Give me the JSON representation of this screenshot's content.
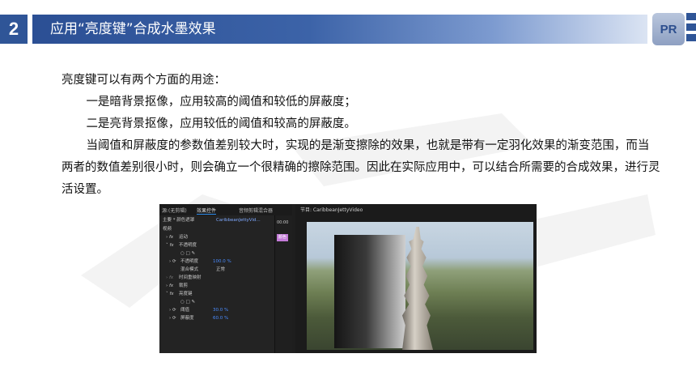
{
  "header": {
    "number": "2",
    "title": "应用“亮度键”合成水墨效果",
    "logo_text": "PR"
  },
  "body": {
    "lines": [
      "亮度键可以有两个方面的用途：",
      "一是暗背景抠像，应用较高的阈值和较低的屏蔽度；",
      "二是亮背景抠像，应用较低的阈值和较高的屏蔽度。",
      "当阈值和屏蔽度的参数值差别较大时，实现的是渐变擦除的效果，也就是带有一定羽化效果的渐变范围，而当两者的数值差别很小时，则会确立一个很精确的擦除范围。因此在实际应用中，可以结合所需要的合成效果，进行灵活设置。"
    ]
  },
  "screenshot": {
    "left_tabs": [
      "源:(无剪辑)",
      "效果控件",
      "音频剪辑混合器"
    ],
    "active_tab": "效果控件",
    "clip_path": "主要 * 颜色遮罩",
    "clip_name": "CaribbeanJettyVid...",
    "time": "00:00",
    "mini_label": "颜色",
    "rows": [
      {
        "label": "视频",
        "value": "",
        "kind": "section"
      },
      {
        "label": "运动",
        "value": "",
        "kind": "fx"
      },
      {
        "label": "不透明度",
        "value": "",
        "kind": "fx"
      },
      {
        "label": "不透明度",
        "value": "100.0 %",
        "kind": "param"
      },
      {
        "label": "混合模式",
        "value": "正常",
        "kind": "param"
      },
      {
        "label": "时间重映射",
        "value": "",
        "kind": "fx"
      },
      {
        "label": "裁剪",
        "value": "",
        "kind": "fx"
      },
      {
        "label": "亮度键",
        "value": "",
        "kind": "fx"
      },
      {
        "label": "阈值",
        "value": "30.0 %",
        "kind": "param"
      },
      {
        "label": "屏蔽度",
        "value": "60.0 %",
        "kind": "param"
      }
    ],
    "program_title": "节目: CaribbeanJettyVideo",
    "colors": {
      "accent": "#2f5597",
      "value_blue": "#4a8cff",
      "label_tag": "#c47bd8"
    }
  }
}
